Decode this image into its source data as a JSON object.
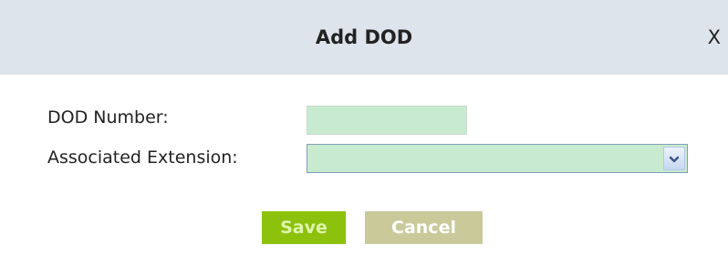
{
  "dialog": {
    "title": "Add DOD",
    "close_label": "X"
  },
  "form": {
    "dod_number_label": "DOD Number:",
    "dod_number_value": "",
    "associated_extension_label": "Associated Extension:",
    "associated_extension_value": ""
  },
  "buttons": {
    "save_label": "Save",
    "cancel_label": "Cancel"
  },
  "colors": {
    "header_bg": "#dde4ec",
    "input_bg": "#c8ebd0",
    "save_bg": "#8cc10c",
    "cancel_bg": "#cac99a"
  },
  "icons": {
    "select_arrow": "chevron-down-icon"
  }
}
